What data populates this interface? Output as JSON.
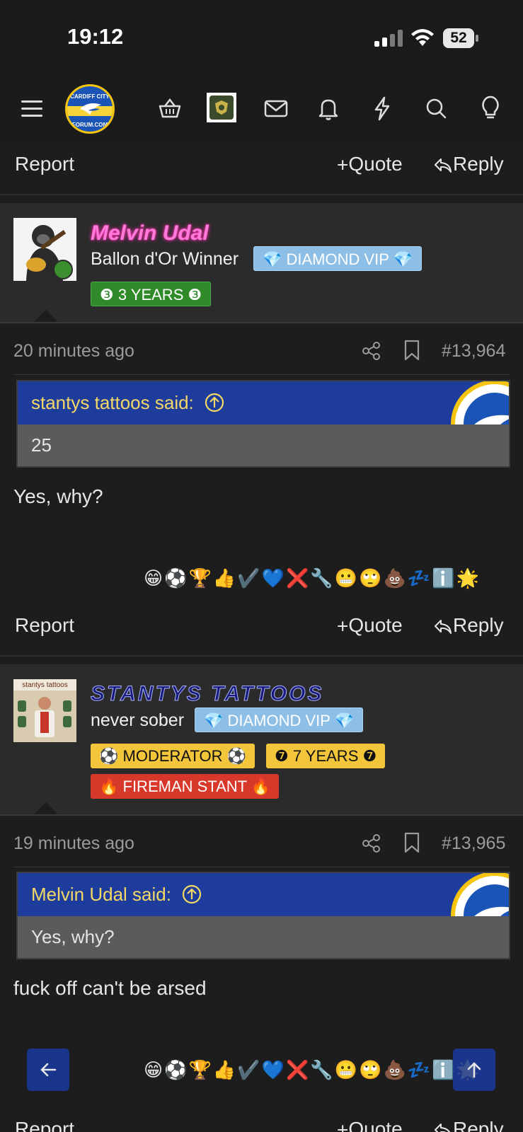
{
  "status_bar": {
    "time": "19:12",
    "battery": "52"
  },
  "nav": {
    "icons": [
      "menu-icon",
      "basket-icon",
      "mail-icon",
      "bell-icon",
      "lightning-icon",
      "search-icon",
      "lightbulb-icon"
    ]
  },
  "actions": {
    "report": "Report",
    "quote": "Quote",
    "reply": "Reply"
  },
  "posts": [
    {
      "username": "Melvin Udal",
      "title": "Ballon d'Or Winner",
      "badges": [
        "💎 DIAMOND VIP 💎",
        "❸ 3 YEARS ❸"
      ],
      "time": "20 minutes ago",
      "number": "#13,964",
      "quote_author": "stantys tattoos said:",
      "quote_text": "25",
      "message": "Yes, why?",
      "reactions": "😁⚽🏆👍✔️💙❌🔧😬🙄💩💤ℹ️🌟"
    },
    {
      "username": "stantys tattoos",
      "title": "never sober",
      "badges": [
        "💎 DIAMOND VIP 💎",
        "⚽ MODERATOR ⚽",
        "❼ 7 YEARS ❼",
        "🔥 FIREMAN STANT 🔥"
      ],
      "time": "19 minutes ago",
      "number": "#13,965",
      "quote_author": "Melvin Udal said:",
      "quote_text": "Yes, why?",
      "message": "fuck off can't be arsed",
      "reactions": "😁⚽🏆👍✔️💙❌🔧😬🙄💩💤ℹ️🌟"
    }
  ],
  "avatar2_caption": "stantys tattoos",
  "colors": {
    "accent": "#1e3c9c",
    "quote_author": "#f3d866",
    "diamond": "#8dbfe6"
  }
}
